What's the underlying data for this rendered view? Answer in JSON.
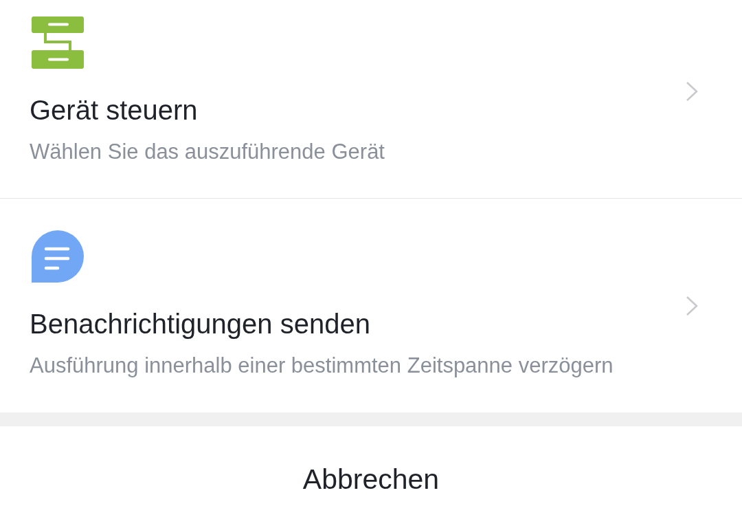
{
  "actions": [
    {
      "kind": "device",
      "title": "Gerät steuern",
      "description": "Wählen Sie das auszuführende Gerät"
    },
    {
      "kind": "notification",
      "title": "Benachrichtigungen senden",
      "description": "Ausführung innerhalb einer bestimmten Zeitspanne verzögern"
    }
  ],
  "cancel_button": {
    "label": "Abbrechen"
  }
}
